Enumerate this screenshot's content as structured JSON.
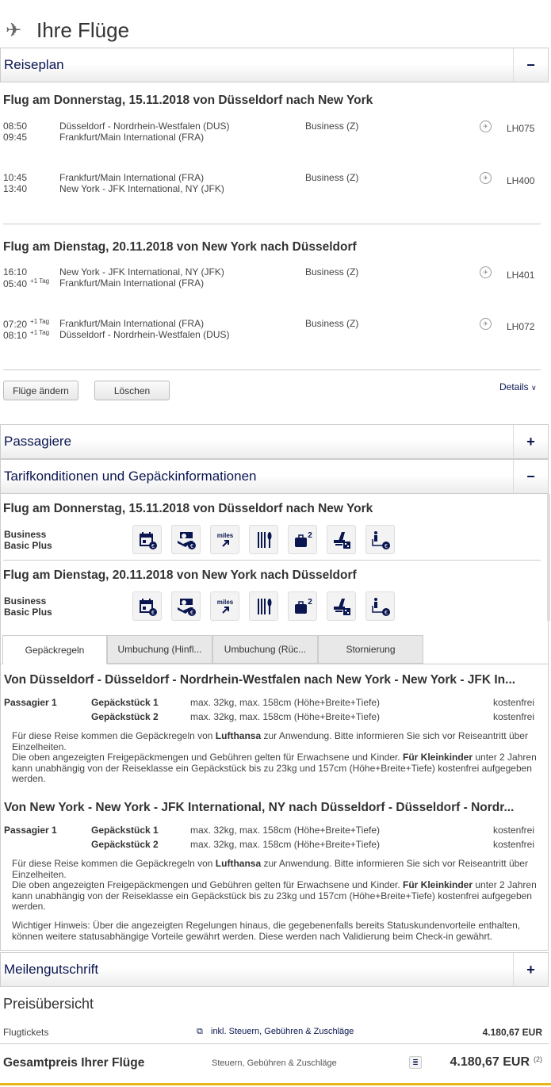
{
  "page": {
    "title": "Ihre Flüge",
    "icon": "plane-icon"
  },
  "accordions": {
    "reiseplan": {
      "title": "Reiseplan",
      "toggle": "−"
    },
    "passagiere": {
      "title": "Passagiere",
      "toggle": "+"
    },
    "tarif": {
      "title": "Tarifkonditionen und Gepäckinformationen",
      "toggle": "−"
    },
    "meilen": {
      "title": "Meilengutschrift",
      "toggle": "+"
    }
  },
  "itinerary": {
    "outbound": {
      "title": "Flug am Donnerstag, 15.11.2018 von Düsseldorf nach New York",
      "segments": [
        {
          "dep_time": "08:50",
          "dep_tag": "",
          "arr_time": "09:45",
          "arr_tag": "",
          "from": "Düsseldorf - Nordrhein-Westfalen (DUS)",
          "to": "Frankfurt/Main International (FRA)",
          "class": "Business (Z)",
          "flight": "LH075"
        },
        {
          "dep_time": "10:45",
          "dep_tag": "",
          "arr_time": "13:40",
          "arr_tag": "",
          "from": "Frankfurt/Main International (FRA)",
          "to": "New York - JFK International, NY (JFK)",
          "class": "Business (Z)",
          "flight": "LH400"
        }
      ]
    },
    "inbound": {
      "title": "Flug am Dienstag, 20.11.2018 von New York nach Düsseldorf",
      "segments": [
        {
          "dep_time": "16:10",
          "dep_tag": "",
          "arr_time": "05:40",
          "arr_tag": "+1 Tag",
          "from": "New York - JFK International, NY (JFK)",
          "to": "Frankfurt/Main International (FRA)",
          "class": "Business (Z)",
          "flight": "LH401"
        },
        {
          "dep_time": "07:20",
          "dep_tag": "+1 Tag",
          "arr_time": "08:10",
          "arr_tag": "+1 Tag",
          "from": "Frankfurt/Main International (FRA)",
          "to": "Düsseldorf - Nordrhein-Westfalen (DUS)",
          "class": "Business (Z)",
          "flight": "LH072"
        }
      ]
    },
    "buttons": {
      "change": "Flüge ändern",
      "delete": "Löschen",
      "details": "Details"
    }
  },
  "fares": [
    {
      "title": "Flug am Donnerstag, 15.11.2018 von Düsseldorf nach New York",
      "fare_line1": "Business",
      "fare_line2": "Basic Plus"
    },
    {
      "title": "Flug am Dienstag, 20.11.2018 von New York nach Düsseldorf",
      "fare_line1": "Business",
      "fare_line2": "Basic Plus"
    }
  ],
  "fare_icons": [
    "rebooking-fee-icon",
    "refund-fee-icon",
    "miles-icon",
    "meal-icon",
    "baggage-icon",
    "seat-reservation-icon",
    "lounge-fee-icon"
  ],
  "fare_icon_texts": {
    "miles": "miles",
    "baggage_count": "2"
  },
  "tabs": [
    "Gepäckregeln",
    "Umbuchung (Hinfl...",
    "Umbuchung (Rüc...",
    "Stornierung"
  ],
  "baggage": {
    "routes": [
      {
        "title": "Von Düsseldorf - Düsseldorf - Nordrhein-Westfalen  nach New York - New York - JFK In...",
        "passenger": "Passagier 1",
        "pieces": [
          {
            "name": "Gepäckstück 1",
            "dims": "max. 32kg, max. 158cm (Höhe+Breite+Tiefe)",
            "fee": "kostenfrei"
          },
          {
            "name": "Gepäckstück 2",
            "dims": "max. 32kg, max. 158cm (Höhe+Breite+Tiefe)",
            "fee": "kostenfrei"
          }
        ],
        "info1_pre": "Für diese Reise kommen die Gepäckregeln von ",
        "info1_bold": "Lufthansa",
        "info1_post": " zur Anwendung. Bitte informieren Sie sich vor Reiseantritt über Einzelheiten.",
        "info2_pre": "Die oben angezeigten Freigepäckmengen und Gebühren gelten für Erwachsene und Kinder. ",
        "info2_bold": "Für Kleinkinder",
        "info2_post": " unter 2 Jahren kann unabhängig von der Reiseklasse ein Gepäckstück bis zu 23kg und 157cm (Höhe+Breite+Tiefe) kostenfrei aufgegeben werden."
      },
      {
        "title": "Von New York - New York - JFK International, NY  nach Düsseldorf - Düsseldorf - Nordr...",
        "passenger": "Passagier 1",
        "pieces": [
          {
            "name": "Gepäckstück 1",
            "dims": "max. 32kg, max. 158cm (Höhe+Breite+Tiefe)",
            "fee": "kostenfrei"
          },
          {
            "name": "Gepäckstück 2",
            "dims": "max. 32kg, max. 158cm (Höhe+Breite+Tiefe)",
            "fee": "kostenfrei"
          }
        ],
        "info1_pre": "Für diese Reise kommen die Gepäckregeln von ",
        "info1_bold": "Lufthansa",
        "info1_post": " zur Anwendung. Bitte informieren Sie sich vor Reiseantritt über Einzelheiten.",
        "info2_pre": "Die oben angezeigten Freigepäckmengen und Gebühren gelten für Erwachsene und Kinder. ",
        "info2_bold": "Für Kleinkinder",
        "info2_post": " unter 2 Jahren kann unabhängig von der Reiseklasse ein Gepäckstück bis zu 23kg und 157cm (Höhe+Breite+Tiefe) kostenfrei aufgegeben werden."
      }
    ],
    "notice": "Wichtiger Hinweis: Über die angezeigten Regelungen hinaus, die gegebenenfalls bereits Statuskundenvorteile enthalten, können weitere statusabhängige Vorteile gewährt werden. Diese werden nach Validierung beim Check-in gewährt."
  },
  "price": {
    "title": "Preisübersicht",
    "tickets_label": "Flugtickets",
    "tickets_note": "inkl. Steuern, Gebühren & Zuschläge",
    "tickets_amount": "4.180,67 EUR",
    "total_label": "Gesamtpreis Ihrer Flüge",
    "total_note": "Steuern, Gebühren & Zuschläge",
    "total_amount": "4.180,67 EUR",
    "total_footnote": "(2)"
  },
  "colors": {
    "brand_navy": "#0a1650",
    "accent_gold": "#e8b71a"
  }
}
